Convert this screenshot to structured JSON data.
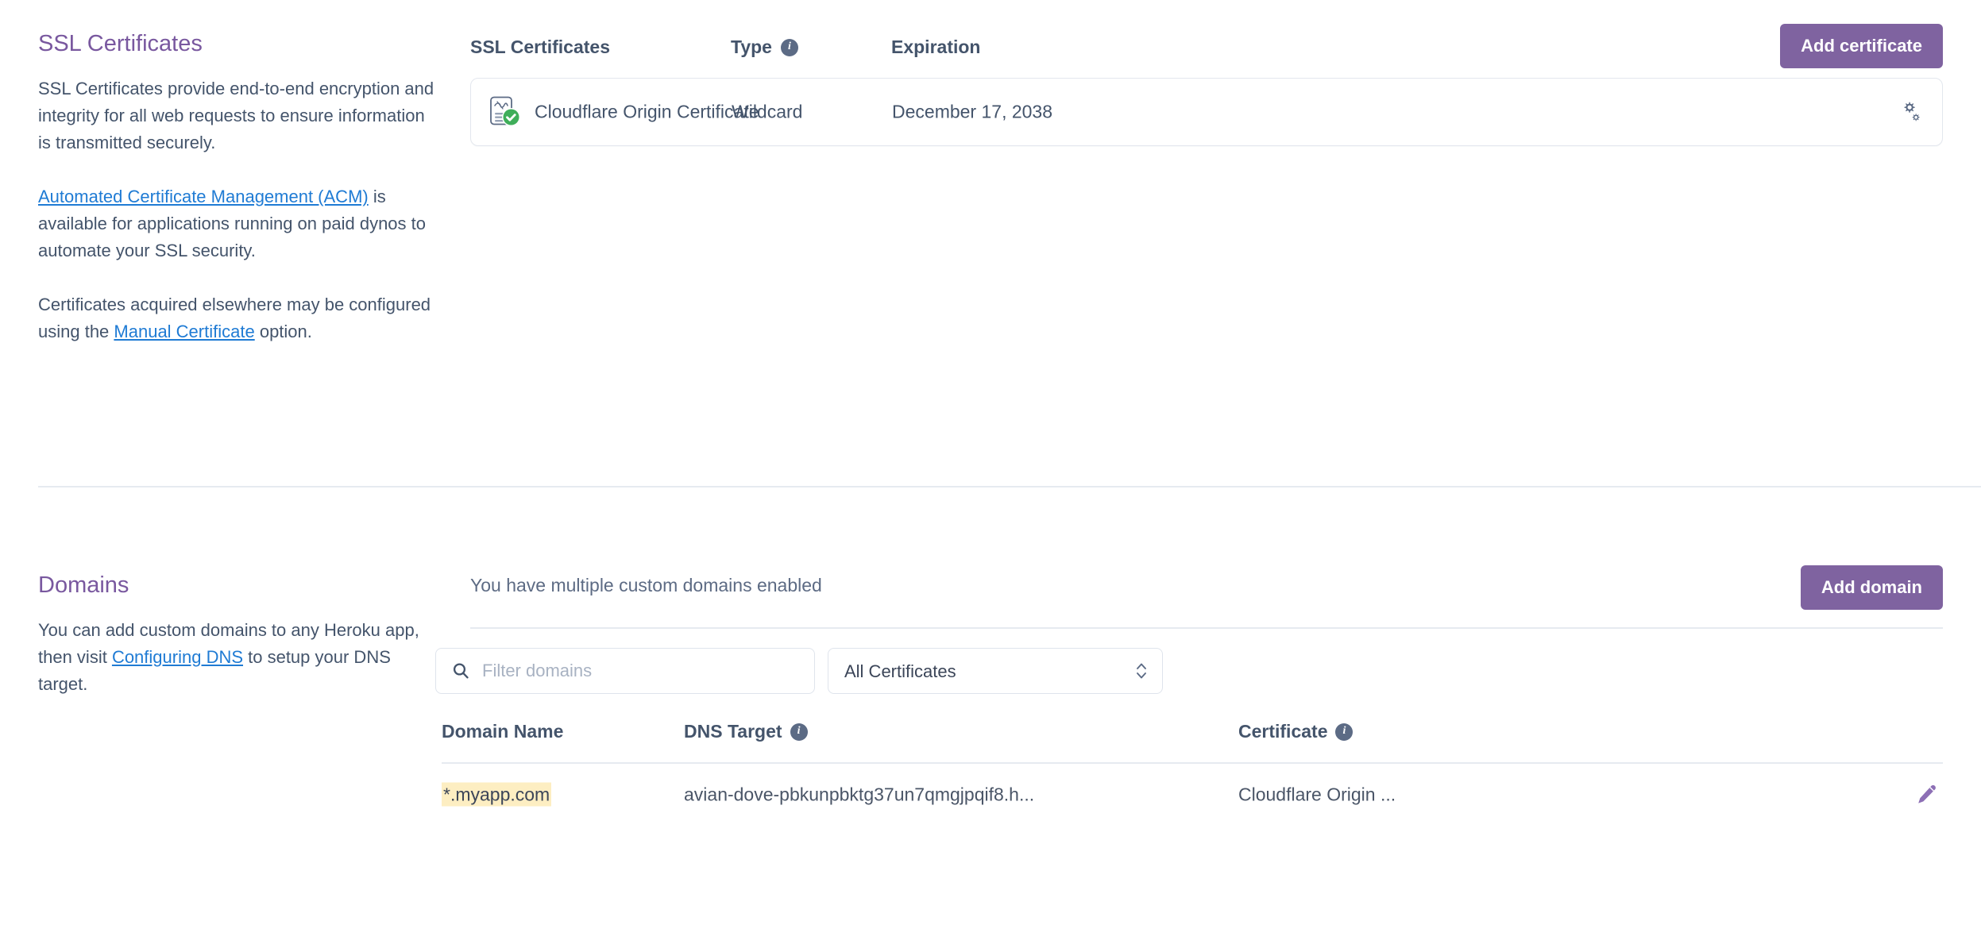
{
  "ssl": {
    "title": "SSL Certificates",
    "paragraph1_text": "SSL Certificates provide end-to-end encryption and integrity for all web requests to ensure information is transmitted securely.",
    "paragraph2_link": "Automated Certificate Management (ACM)",
    "paragraph2_rest": " is available for applications running on paid dynos to automate your SSL security.",
    "paragraph3_before": "Certificates acquired elsewhere may be configured using the ",
    "paragraph3_link": "Manual Certificate",
    "paragraph3_after": " option.",
    "columns": {
      "name": "SSL Certificates",
      "type": "Type",
      "expiration": "Expiration"
    },
    "add_button": "Add certificate",
    "rows": [
      {
        "icon": "certificate-verified-icon",
        "name": "Cloudflare Origin Certificate",
        "type": "Wildcard",
        "expiration": "December 17, 2038",
        "action_icon": "gears-settings-icon"
      }
    ]
  },
  "domains": {
    "title": "Domains",
    "paragraph_before": "You can add custom domains to any Heroku app, then visit ",
    "paragraph_link": "Configuring DNS",
    "paragraph_after": " to setup your DNS target.",
    "status_note": "You have multiple custom domains enabled",
    "add_button": "Add domain",
    "filter_placeholder": "Filter domains",
    "filter_value": "",
    "certificate_filter_selected": "All Certificates",
    "certificate_filter_options": [
      "All Certificates"
    ],
    "columns": {
      "domain_name": "Domain Name",
      "dns_target": "DNS Target",
      "certificate": "Certificate"
    },
    "rows": [
      {
        "domain_name": "*.myapp.com",
        "dns_target": "avian-dove-pbkunpbktg37un7qmgjpqif8.h...",
        "certificate": "Cloudflare Origin ...",
        "action_icon": "edit-pencil-icon"
      }
    ]
  },
  "colors": {
    "heading_purple": "#79589f",
    "button_purple": "#7f63a0",
    "link_blue": "#1f7bd4",
    "text_slate": "#44546b",
    "highlight_yellow": "#fdeec2",
    "check_green": "#3fae5a",
    "pencil_purple": "#8d6fb5",
    "border_grey": "#e3e7ee"
  }
}
